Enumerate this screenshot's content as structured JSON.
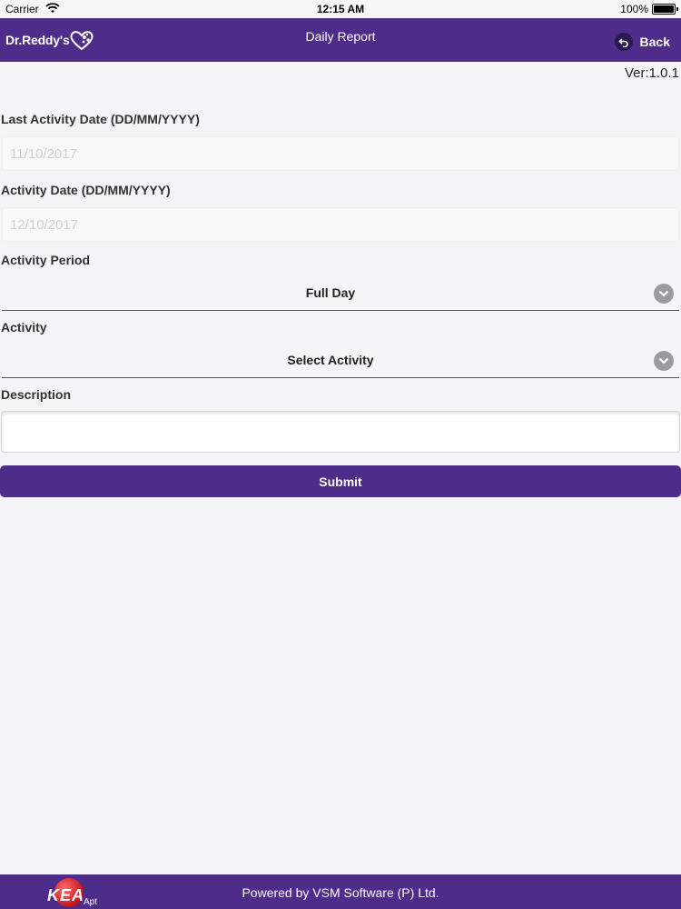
{
  "status_bar": {
    "carrier": "Carrier",
    "time": "12:15 AM",
    "battery": "100%"
  },
  "nav": {
    "logo_text": "Dr.Reddy's",
    "title": "Daily Report",
    "back_label": "Back"
  },
  "version": "Ver:1.0.1",
  "form": {
    "last_activity_label": "Last Activity Date (DD/MM/YYYY)",
    "last_activity_value": "11/10/2017",
    "activity_date_label": "Activity Date (DD/MM/YYYY)",
    "activity_date_value": "12/10/2017",
    "period_label": "Activity Period",
    "period_value": "Full Day",
    "activity_label": "Activity",
    "activity_value": "Select Activity",
    "description_label": "Description",
    "description_value": "",
    "submit_label": "Submit"
  },
  "footer": {
    "logo_text": "KEA",
    "logo_sub": "Apt",
    "powered_by": "Powered by VSM Software (P) Ltd."
  },
  "colors": {
    "brand": "#4e2c8a",
    "background": "#f5f5f7"
  }
}
